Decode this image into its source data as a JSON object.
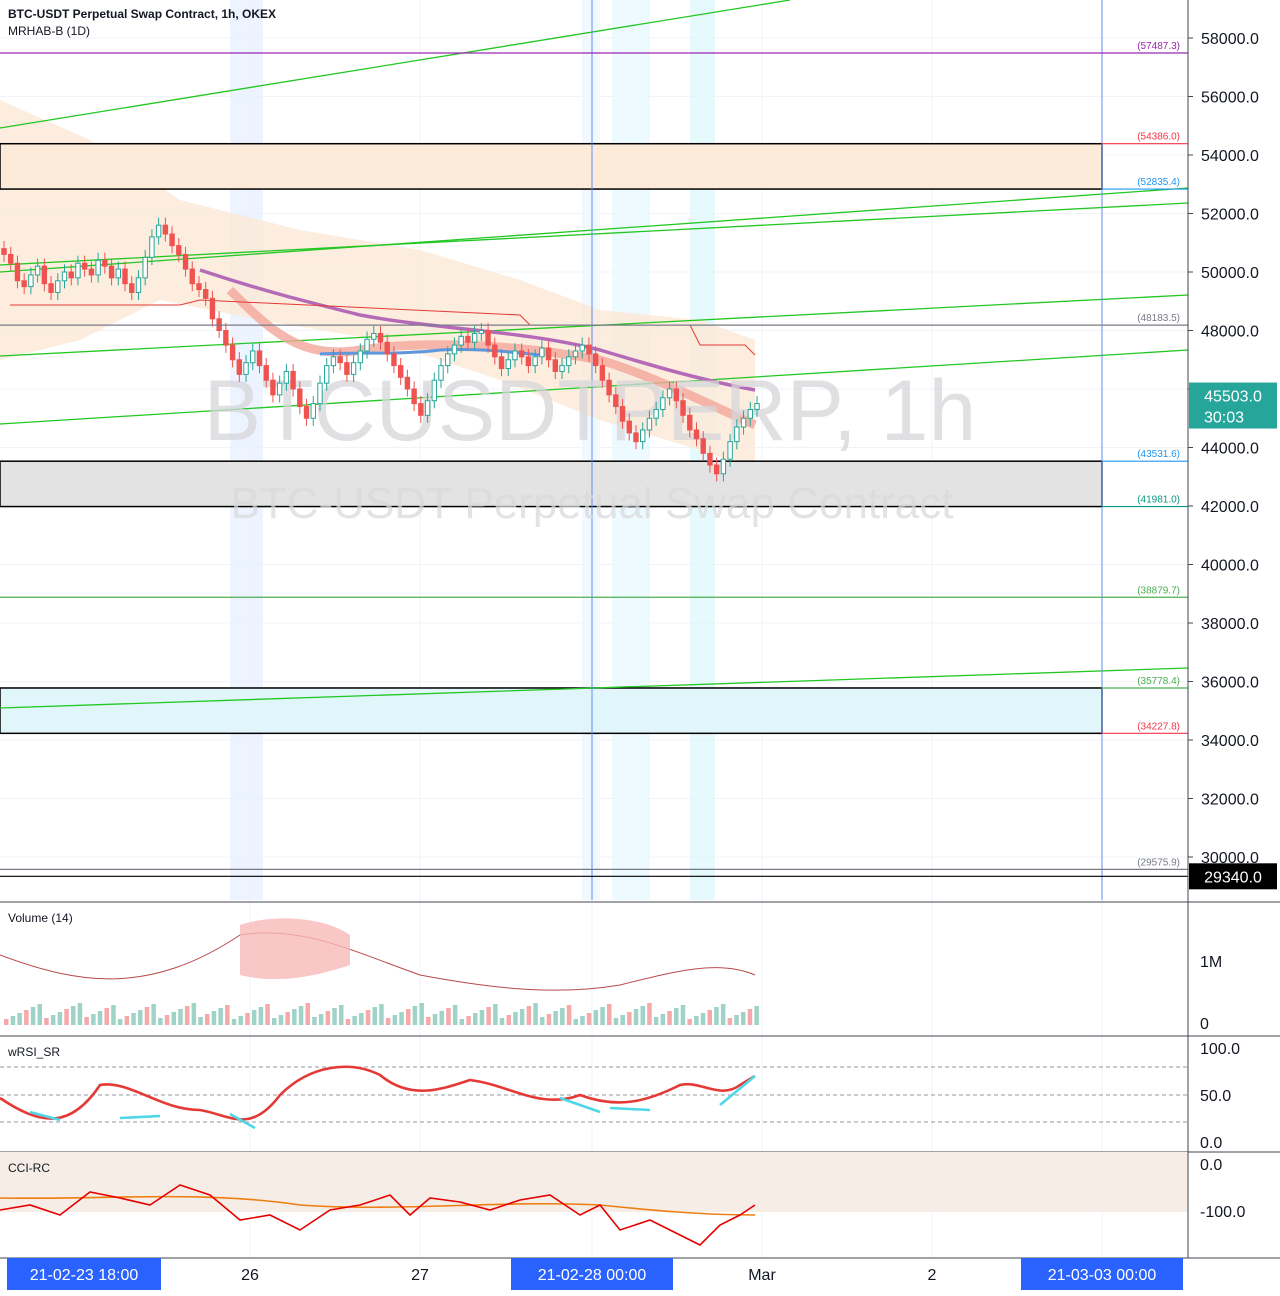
{
  "header": {
    "symbol_line": "BTC-USDT Perpetual Swap Contract, 1h, OKEX",
    "indicator_line": "MRHAB-B (1D)"
  },
  "watermark": {
    "ticker": "BTCUSDTPERP, 1h",
    "description": "BTC-USDT Perpetual Swap Contract"
  },
  "price_axis": {
    "ticks": [
      "58000.0",
      "56000.0",
      "54000.0",
      "52000.0",
      "50000.0",
      "48000.0",
      "46000.0",
      "44000.0",
      "42000.0",
      "40000.0",
      "38000.0",
      "36000.0",
      "34000.0",
      "32000.0",
      "30000.0"
    ],
    "tick_values": [
      58000,
      56000,
      54000,
      52000,
      50000,
      48000,
      46000,
      44000,
      42000,
      40000,
      38000,
      36000,
      34000,
      32000,
      30000
    ],
    "range": [
      29050,
      59300
    ],
    "last_price": "45503.0",
    "countdown": "30:03",
    "last_price_value": 45503,
    "low_marker": "29340.0",
    "low_marker_value": 29340
  },
  "levels": [
    {
      "label": "(57487.3)",
      "value": 57487.3,
      "color": "#9c27b0"
    },
    {
      "label": "(54386.0)",
      "value": 54386.0,
      "color": "#f23645"
    },
    {
      "label": "(52835.4)",
      "value": 52835.4,
      "color": "#2196f3"
    },
    {
      "label": "(48183.5)",
      "value": 48183.5,
      "color": "#787b86"
    },
    {
      "label": "(43531.6)",
      "value": 43531.6,
      "color": "#2196f3"
    },
    {
      "label": "(41981.0)",
      "value": 41981.0,
      "color": "#089981"
    },
    {
      "label": "(38879.7)",
      "value": 38879.7,
      "color": "#4caf50"
    },
    {
      "label": "(35778.4)",
      "value": 35778.4,
      "color": "#4caf50"
    },
    {
      "label": "(34227.8)",
      "value": 34227.8,
      "color": "#f23645"
    },
    {
      "label": "(29575.9)",
      "value": 29575.9,
      "color": "#787b86"
    }
  ],
  "zones": [
    {
      "top": 54386.0,
      "bottom": 52835.4,
      "fill": "#fdebd9"
    },
    {
      "top": 43531.6,
      "bottom": 41981.0,
      "fill": "#e3e3e3"
    },
    {
      "top": 35778.4,
      "bottom": 34227.8,
      "fill": "#e0f6fb"
    }
  ],
  "time_axis": {
    "labels": [
      "21-02-23   18:00",
      "26",
      "27",
      "21-02-28   00:00",
      "Mar",
      "2",
      "21-03-03   00:00"
    ],
    "highlighted": [
      true,
      false,
      false,
      true,
      false,
      false,
      true
    ]
  },
  "panes": {
    "volume": {
      "title": "Volume (14)",
      "ticks": [
        "1M",
        "0"
      ]
    },
    "rsi": {
      "title": "wRSI_SR",
      "ticks": [
        "100.0",
        "50.0",
        "0.0"
      ]
    },
    "cci": {
      "title": "CCI-RC",
      "ticks": [
        "0.0",
        "-100.0"
      ]
    }
  },
  "chart_data": {
    "type": "candlestick",
    "symbol": "BTC-USDT Perpetual Swap Contract",
    "interval": "1h",
    "exchange": "OKEX",
    "y_range": [
      29050,
      59300
    ],
    "last_price": 45503.0,
    "ohlc_close": [
      50600,
      50300,
      49700,
      49500,
      49900,
      50200,
      49600,
      49300,
      49700,
      50000,
      49800,
      50300,
      50100,
      49900,
      50400,
      50200,
      49800,
      50100,
      49600,
      49300,
      49800,
      50500,
      51200,
      51600,
      51300,
      50900,
      50600,
      50100,
      49600,
      49400,
      49100,
      48400,
      48000,
      47500,
      47000,
      46500,
      46900,
      47300,
      46800,
      46300,
      45800,
      46200,
      46600,
      46000,
      45400,
      45000,
      45500,
      46200,
      46800,
      47100,
      46900,
      46500,
      46900,
      47300,
      47700,
      47900,
      47600,
      47200,
      46800,
      46400,
      46000,
      45500,
      45100,
      45600,
      46300,
      46800,
      47200,
      47500,
      47800,
      47600,
      47900,
      48000,
      47500,
      47100,
      46700,
      47000,
      47300,
      47100,
      46800,
      47100,
      47400,
      47000,
      46600,
      46800,
      47100,
      47300,
      47500,
      47200,
      46800,
      46300,
      45800,
      45400,
      44900,
      44500,
      44200,
      44600,
      45000,
      45300,
      45700,
      46000,
      45600,
      45100,
      44600,
      44300,
      43800,
      43400,
      43100,
      43600,
      44200,
      44700,
      45000,
      45300,
      45503
    ]
  }
}
